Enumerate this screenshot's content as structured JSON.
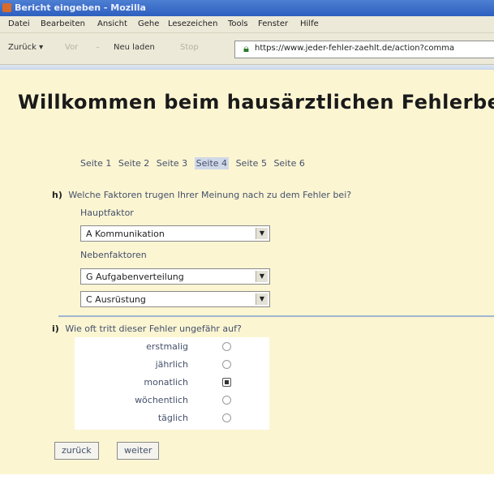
{
  "window": {
    "title": "Bericht eingeben - Mozilla"
  },
  "menu": {
    "items": [
      "Datei",
      "Bearbeiten",
      "Ansicht",
      "Gehe",
      "Lesezeichen",
      "Tools",
      "Fenster",
      "Hilfe"
    ]
  },
  "toolbar": {
    "back": "Zurück",
    "forward": "Vor",
    "reload": "Neu laden",
    "stop": "Stop",
    "url": "https://www.jeder-fehler-zaehlt.de/action?comma"
  },
  "page": {
    "heading": "Willkommen beim hausärztlichen Fehlerberich",
    "pages": [
      "Seite 1",
      "Seite 2",
      "Seite 3",
      "Seite 4",
      "Seite 5",
      "Seite 6"
    ],
    "current_page": "Seite 4"
  },
  "question_h": {
    "label": "h)",
    "text": "Welche Faktoren trugen Ihrer Meinung nach zu dem Fehler bei?",
    "main_factor_label": "Hauptfaktor",
    "main_factor_value": "A Kommunikation",
    "side_factors_label": "Nebenfaktoren",
    "side_factor_1": "G Aufgabenverteilung",
    "side_factor_2": "C Ausrüstung"
  },
  "question_i": {
    "label": "i)",
    "text": "Wie oft tritt dieser Fehler ungefähr auf?",
    "options": [
      "erstmalig",
      "jährlich",
      "monatlich",
      "wöchentlich",
      "täglich"
    ],
    "selected": "monatlich"
  },
  "buttons": {
    "back": "zurück",
    "next": "weiter"
  }
}
